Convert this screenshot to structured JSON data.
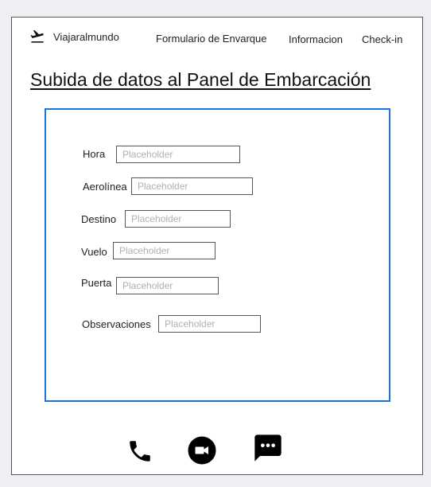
{
  "header": {
    "brand": "Viajaralmundo",
    "logo_icon": "airplane-takeoff-icon",
    "nav": [
      {
        "label": "Formulario de Envarque"
      },
      {
        "label": "Informacion"
      },
      {
        "label": "Check-in"
      }
    ]
  },
  "page_title": "Subida de datos al Panel de Embarcación",
  "form": {
    "accent_color": "#1a73e8",
    "fields": [
      {
        "label": "Hora",
        "placeholder": "Placeholder",
        "value": ""
      },
      {
        "label": "Aerolínea",
        "placeholder": "Placeholder",
        "value": ""
      },
      {
        "label": "Destino",
        "placeholder": "Placeholder",
        "value": ""
      },
      {
        "label": "Vuelo",
        "placeholder": "Placeholder",
        "value": ""
      },
      {
        "label": "Puerta",
        "placeholder": "Placeholder",
        "value": ""
      },
      {
        "label": "Observaciones",
        "placeholder": "Placeholder",
        "value": ""
      }
    ]
  },
  "footer": {
    "icons": [
      "phone-icon",
      "video-call-icon",
      "chat-icon"
    ]
  }
}
